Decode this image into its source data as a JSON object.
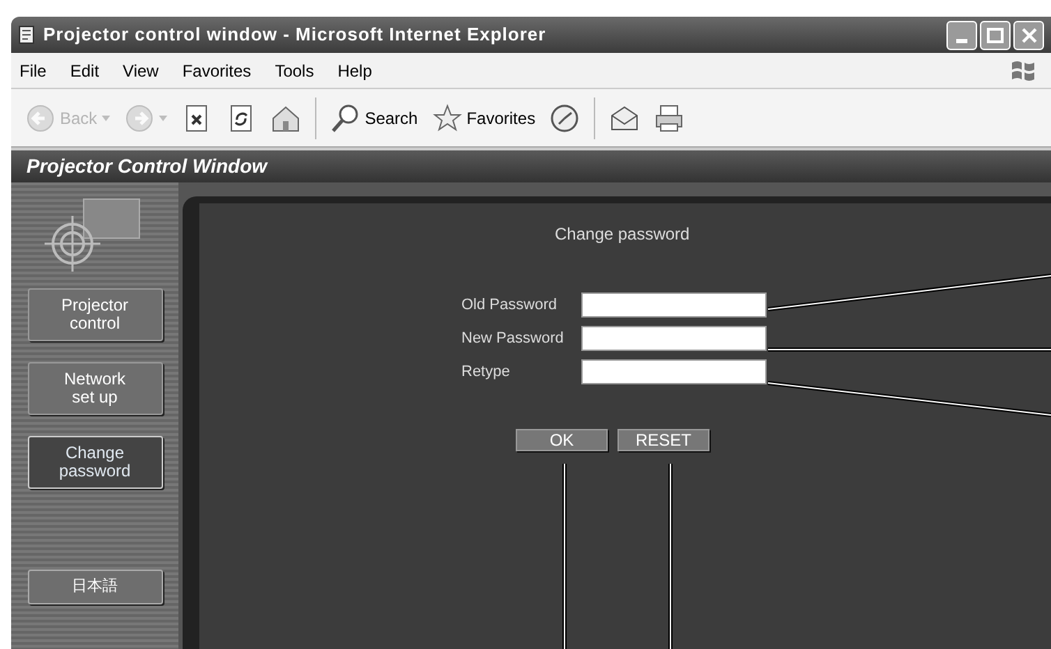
{
  "window": {
    "title": "Projector control window - Microsoft Internet Explorer"
  },
  "menu": [
    "File",
    "Edit",
    "View",
    "Favorites",
    "Tools",
    "Help"
  ],
  "toolbar": [
    {
      "kind": "back",
      "label": "Back",
      "disabled": true
    },
    {
      "kind": "forward",
      "disabled": true
    },
    {
      "kind": "stop"
    },
    {
      "kind": "refresh"
    },
    {
      "kind": "home"
    },
    {
      "kind": "sep"
    },
    {
      "kind": "search",
      "label": "Search"
    },
    {
      "kind": "favorites",
      "label": "Favorites"
    },
    {
      "kind": "history"
    },
    {
      "kind": "sep"
    },
    {
      "kind": "mail"
    },
    {
      "kind": "print"
    }
  ],
  "app_header": {
    "title": "Projector Control Window"
  },
  "sidebar": {
    "items": [
      {
        "label": "Projector\ncontrol",
        "selected": false
      },
      {
        "label": "Network\nset up",
        "selected": false
      },
      {
        "label": "Change\npassword",
        "selected": true
      }
    ],
    "language_button": "日本語"
  },
  "form": {
    "title": "Change password",
    "fields": [
      {
        "label": "Old Password"
      },
      {
        "label": "New Password"
      },
      {
        "label": "Retype"
      }
    ],
    "buttons": [
      "OK",
      "RESET"
    ]
  }
}
